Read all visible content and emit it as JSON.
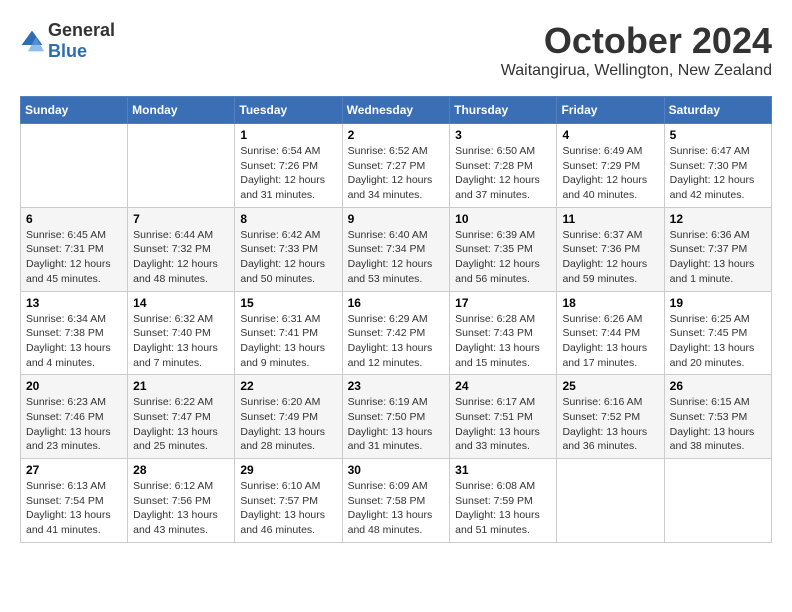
{
  "logo": {
    "general": "General",
    "blue": "Blue"
  },
  "title": "October 2024",
  "location": "Waitangirua, Wellington, New Zealand",
  "weekdays": [
    "Sunday",
    "Monday",
    "Tuesday",
    "Wednesday",
    "Thursday",
    "Friday",
    "Saturday"
  ],
  "weeks": [
    [
      {
        "day": "",
        "info": ""
      },
      {
        "day": "",
        "info": ""
      },
      {
        "day": "1",
        "info": "Sunrise: 6:54 AM\nSunset: 7:26 PM\nDaylight: 12 hours\nand 31 minutes."
      },
      {
        "day": "2",
        "info": "Sunrise: 6:52 AM\nSunset: 7:27 PM\nDaylight: 12 hours\nand 34 minutes."
      },
      {
        "day": "3",
        "info": "Sunrise: 6:50 AM\nSunset: 7:28 PM\nDaylight: 12 hours\nand 37 minutes."
      },
      {
        "day": "4",
        "info": "Sunrise: 6:49 AM\nSunset: 7:29 PM\nDaylight: 12 hours\nand 40 minutes."
      },
      {
        "day": "5",
        "info": "Sunrise: 6:47 AM\nSunset: 7:30 PM\nDaylight: 12 hours\nand 42 minutes."
      }
    ],
    [
      {
        "day": "6",
        "info": "Sunrise: 6:45 AM\nSunset: 7:31 PM\nDaylight: 12 hours\nand 45 minutes."
      },
      {
        "day": "7",
        "info": "Sunrise: 6:44 AM\nSunset: 7:32 PM\nDaylight: 12 hours\nand 48 minutes."
      },
      {
        "day": "8",
        "info": "Sunrise: 6:42 AM\nSunset: 7:33 PM\nDaylight: 12 hours\nand 50 minutes."
      },
      {
        "day": "9",
        "info": "Sunrise: 6:40 AM\nSunset: 7:34 PM\nDaylight: 12 hours\nand 53 minutes."
      },
      {
        "day": "10",
        "info": "Sunrise: 6:39 AM\nSunset: 7:35 PM\nDaylight: 12 hours\nand 56 minutes."
      },
      {
        "day": "11",
        "info": "Sunrise: 6:37 AM\nSunset: 7:36 PM\nDaylight: 12 hours\nand 59 minutes."
      },
      {
        "day": "12",
        "info": "Sunrise: 6:36 AM\nSunset: 7:37 PM\nDaylight: 13 hours\nand 1 minute."
      }
    ],
    [
      {
        "day": "13",
        "info": "Sunrise: 6:34 AM\nSunset: 7:38 PM\nDaylight: 13 hours\nand 4 minutes."
      },
      {
        "day": "14",
        "info": "Sunrise: 6:32 AM\nSunset: 7:40 PM\nDaylight: 13 hours\nand 7 minutes."
      },
      {
        "day": "15",
        "info": "Sunrise: 6:31 AM\nSunset: 7:41 PM\nDaylight: 13 hours\nand 9 minutes."
      },
      {
        "day": "16",
        "info": "Sunrise: 6:29 AM\nSunset: 7:42 PM\nDaylight: 13 hours\nand 12 minutes."
      },
      {
        "day": "17",
        "info": "Sunrise: 6:28 AM\nSunset: 7:43 PM\nDaylight: 13 hours\nand 15 minutes."
      },
      {
        "day": "18",
        "info": "Sunrise: 6:26 AM\nSunset: 7:44 PM\nDaylight: 13 hours\nand 17 minutes."
      },
      {
        "day": "19",
        "info": "Sunrise: 6:25 AM\nSunset: 7:45 PM\nDaylight: 13 hours\nand 20 minutes."
      }
    ],
    [
      {
        "day": "20",
        "info": "Sunrise: 6:23 AM\nSunset: 7:46 PM\nDaylight: 13 hours\nand 23 minutes."
      },
      {
        "day": "21",
        "info": "Sunrise: 6:22 AM\nSunset: 7:47 PM\nDaylight: 13 hours\nand 25 minutes."
      },
      {
        "day": "22",
        "info": "Sunrise: 6:20 AM\nSunset: 7:49 PM\nDaylight: 13 hours\nand 28 minutes."
      },
      {
        "day": "23",
        "info": "Sunrise: 6:19 AM\nSunset: 7:50 PM\nDaylight: 13 hours\nand 31 minutes."
      },
      {
        "day": "24",
        "info": "Sunrise: 6:17 AM\nSunset: 7:51 PM\nDaylight: 13 hours\nand 33 minutes."
      },
      {
        "day": "25",
        "info": "Sunrise: 6:16 AM\nSunset: 7:52 PM\nDaylight: 13 hours\nand 36 minutes."
      },
      {
        "day": "26",
        "info": "Sunrise: 6:15 AM\nSunset: 7:53 PM\nDaylight: 13 hours\nand 38 minutes."
      }
    ],
    [
      {
        "day": "27",
        "info": "Sunrise: 6:13 AM\nSunset: 7:54 PM\nDaylight: 13 hours\nand 41 minutes."
      },
      {
        "day": "28",
        "info": "Sunrise: 6:12 AM\nSunset: 7:56 PM\nDaylight: 13 hours\nand 43 minutes."
      },
      {
        "day": "29",
        "info": "Sunrise: 6:10 AM\nSunset: 7:57 PM\nDaylight: 13 hours\nand 46 minutes."
      },
      {
        "day": "30",
        "info": "Sunrise: 6:09 AM\nSunset: 7:58 PM\nDaylight: 13 hours\nand 48 minutes."
      },
      {
        "day": "31",
        "info": "Sunrise: 6:08 AM\nSunset: 7:59 PM\nDaylight: 13 hours\nand 51 minutes."
      },
      {
        "day": "",
        "info": ""
      },
      {
        "day": "",
        "info": ""
      }
    ]
  ]
}
